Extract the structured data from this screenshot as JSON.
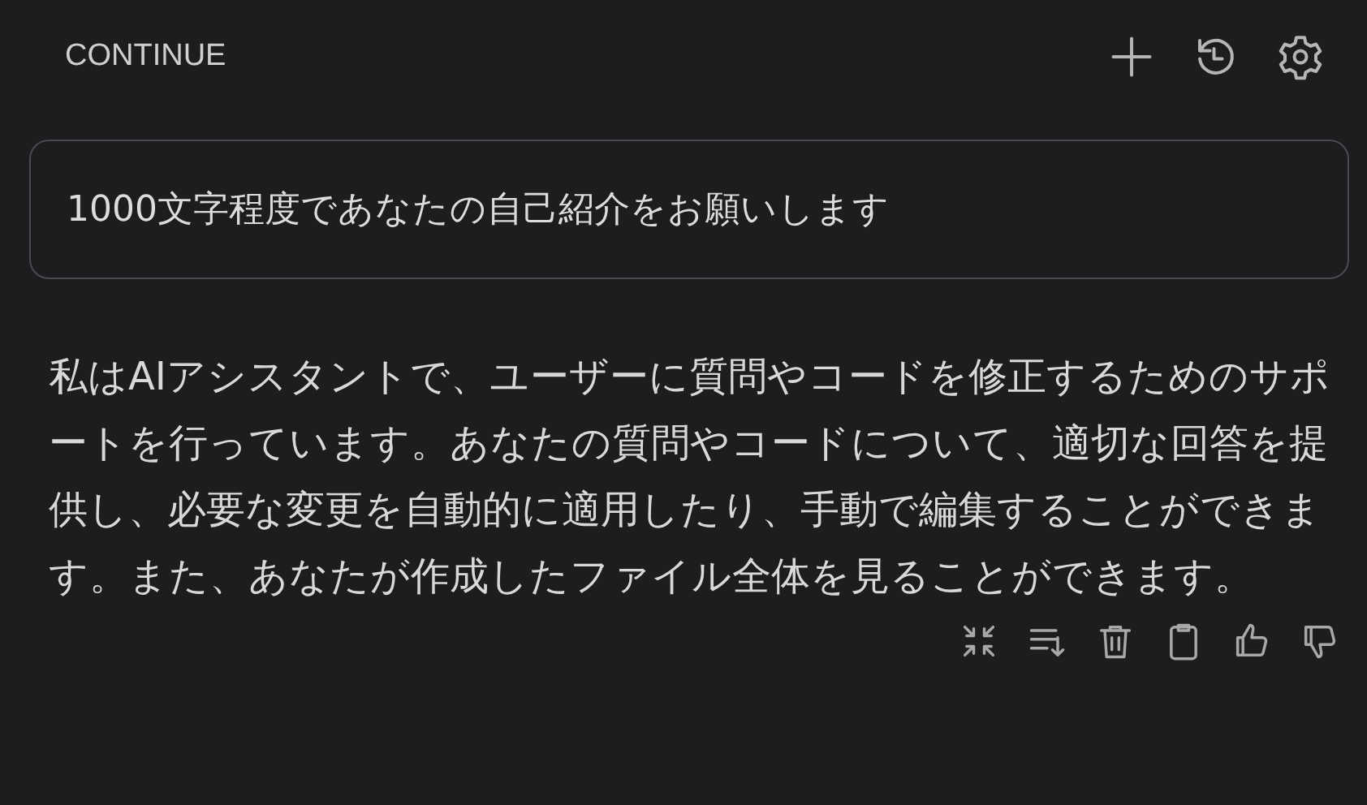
{
  "header": {
    "title": "CONTINUE"
  },
  "prompt": {
    "text": "1000文字程度であなたの自己紹介をお願いします"
  },
  "response": {
    "text": "私はAIアシスタントで、ユーザーに質問やコードを修正するためのサポートを行っています。あなたの質問やコードについて、適切な回答を提供し、必要な変更を自動的に適用したり、手動で編集することができます。また、あなたが作成したファイル全体を見ることができます。"
  }
}
